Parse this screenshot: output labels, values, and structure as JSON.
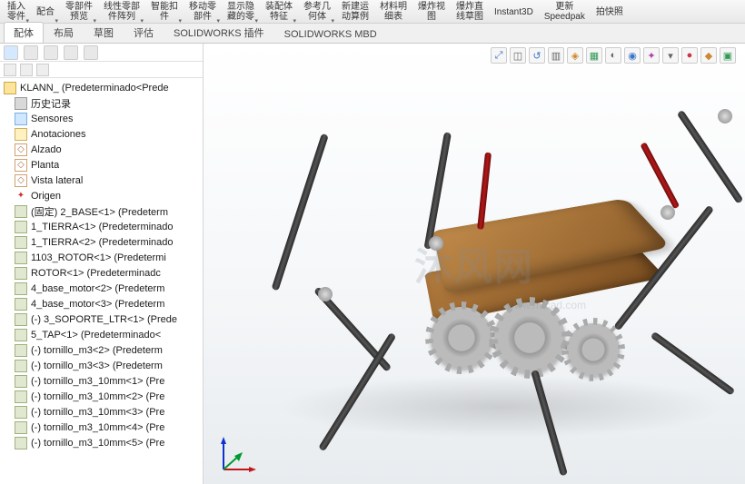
{
  "ribbon": {
    "items": [
      {
        "l1": "插入",
        "l2": "零件"
      },
      {
        "l1": "配合",
        "l2": ""
      },
      {
        "l1": "零部件",
        "l2": "预览"
      },
      {
        "l1": "线性零部",
        "l2": "件阵列"
      },
      {
        "l1": "智能扣",
        "l2": "件"
      },
      {
        "l1": "移动零",
        "l2": "部件"
      },
      {
        "l1": "显示隐",
        "l2": "藏的零"
      },
      {
        "l1": "装配体",
        "l2": "特征"
      },
      {
        "l1": "参考几",
        "l2": "何体"
      },
      {
        "l1": "新建运",
        "l2": "动算例"
      },
      {
        "l1": "材料明",
        "l2": "细表"
      },
      {
        "l1": "爆炸视",
        "l2": "图"
      },
      {
        "l1": "爆炸直",
        "l2": "线草图"
      },
      {
        "l1": "Instant3D",
        "l2": ""
      },
      {
        "l1": "更新",
        "l2": "Speedpak"
      },
      {
        "l1": "拍快照",
        "l2": ""
      }
    ]
  },
  "tabs": [
    "配体",
    "布局",
    "草图",
    "评估",
    "SOLIDWORKS 插件",
    "SOLIDWORKS MBD"
  ],
  "active_tab": 0,
  "tree": {
    "root": "KLANN_  (Predeterminado<Prede",
    "items": [
      {
        "t": "历史记录",
        "k": "hist"
      },
      {
        "t": "Sensores",
        "k": "sens"
      },
      {
        "t": "Anotaciones",
        "k": "anno"
      },
      {
        "t": "Alzado",
        "k": "plane"
      },
      {
        "t": "Planta",
        "k": "plane"
      },
      {
        "t": "Vista lateral",
        "k": "plane"
      },
      {
        "t": "Origen",
        "k": "origin"
      },
      {
        "t": "(固定) 2_BASE<1> (Predeterm",
        "k": "part"
      },
      {
        "t": "1_TIERRA<1> (Predeterminado",
        "k": "part"
      },
      {
        "t": "1_TIERRA<2> (Predeterminado",
        "k": "part"
      },
      {
        "t": "1103_ROTOR<1> (Predetermi",
        "k": "part"
      },
      {
        "t": "ROTOR<1> (Predeterminadc",
        "k": "part"
      },
      {
        "t": "4_base_motor<2> (Predeterm",
        "k": "part"
      },
      {
        "t": "4_base_motor<3> (Predeterm",
        "k": "part"
      },
      {
        "t": "(-) 3_SOPORTE_LTR<1> (Prede",
        "k": "part"
      },
      {
        "t": "5_TAP<1> (Predeterminado<",
        "k": "part"
      },
      {
        "t": "(-) tornillo_m3<2> (Predeterm",
        "k": "part"
      },
      {
        "t": "(-) tornillo_m3<3> (Predeterm",
        "k": "part"
      },
      {
        "t": "(-) tornillo_m3_10mm<1> (Pre",
        "k": "part"
      },
      {
        "t": "(-) tornillo_m3_10mm<2> (Pre",
        "k": "part"
      },
      {
        "t": "(-) tornillo_m3_10mm<3> (Pre",
        "k": "part"
      },
      {
        "t": "(-) tornillo_m3_10mm<4> (Pre",
        "k": "part"
      },
      {
        "t": "(-) tornillo_m3_10mm<5> (Pre",
        "k": "part"
      }
    ]
  },
  "watermark": {
    "text": "沐风网",
    "url": "www.mfcad.com"
  }
}
